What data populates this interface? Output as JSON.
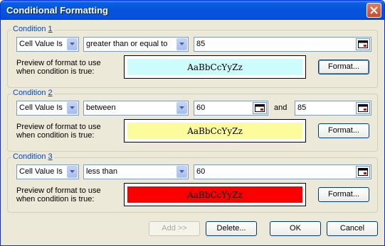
{
  "window": {
    "title": "Conditional Formatting"
  },
  "conditions": [
    {
      "heading": "Condition ",
      "num": "1",
      "type": "Cell Value Is",
      "operator": "greater than or equal to",
      "value1": "85",
      "preview_label_1": "Preview of format to use",
      "preview_label_2": "when condition is true:",
      "preview_text": "AaBbCcYyZz",
      "preview_bg": "#ccfcfc",
      "format_label": "Format..."
    },
    {
      "heading": "Condition ",
      "num": "2",
      "type": "Cell Value Is",
      "operator": "between",
      "value1": "60",
      "and_label": "and",
      "value2": "85",
      "preview_label_1": "Preview of format to use",
      "preview_label_2": "when condition is true:",
      "preview_text": "AaBbCcYyZz",
      "preview_bg": "#fcfc9c",
      "format_label": "Format..."
    },
    {
      "heading": "Condition ",
      "num": "3",
      "type": "Cell Value Is",
      "operator": "less than",
      "value1": "60",
      "preview_label_1": "Preview of format to use",
      "preview_label_2": "when condition is true:",
      "preview_text": "AaBbCcYyZz",
      "preview_bg": "#fc0000",
      "format_label": "Format..."
    }
  ],
  "buttons": {
    "add": "Add >>",
    "delete": "Delete...",
    "ok": "OK",
    "cancel": "Cancel"
  },
  "icons": {
    "close": "close-icon",
    "dropdown": "chevron-down-icon",
    "range": "collapse-dialog-icon"
  }
}
